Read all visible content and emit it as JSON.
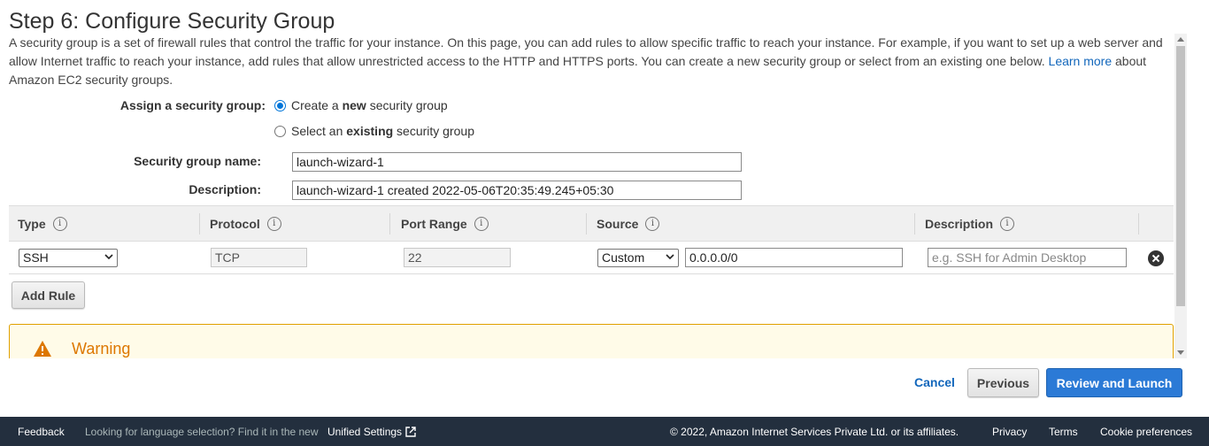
{
  "page": {
    "title": "Step 6: Configure Security Group",
    "intro_text": "A security group is a set of firewall rules that control the traffic for your instance. On this page, you can add rules to allow specific traffic to reach your instance. For example, if you want to set up a web server and allow Internet traffic to reach your instance, add rules that allow unrestricted access to the HTTP and HTTPS ports. You can create a new security group or select from an existing one below.",
    "learn_more_link": "Learn more",
    "intro_suffix": "about Amazon EC2 security groups."
  },
  "assign": {
    "label": "Assign a security group:",
    "option_new": {
      "prefix": "Create a ",
      "bold": "new",
      "suffix": " security group",
      "selected": true
    },
    "option_existing": {
      "prefix": "Select an ",
      "bold": "existing",
      "suffix": " security group",
      "selected": false
    }
  },
  "group_name": {
    "label": "Security group name:",
    "value": "launch-wizard-1"
  },
  "description": {
    "label": "Description:",
    "value": "launch-wizard-1 created 2022-05-06T20:35:49.245+05:30"
  },
  "rules_table": {
    "columns": [
      "Type",
      "Protocol",
      "Port Range",
      "Source",
      "Description"
    ],
    "info_glyph": "i",
    "rows": [
      {
        "type": "SSH",
        "protocol": "TCP",
        "port_range": "22",
        "source_mode": "Custom",
        "source_cidr": "0.0.0.0/0",
        "description_placeholder": "e.g. SSH for Admin Desktop"
      }
    ]
  },
  "add_rule_label": "Add Rule",
  "warning": {
    "title": "Warning",
    "color": "#dd7700"
  },
  "actions": {
    "cancel": "Cancel",
    "previous": "Previous",
    "review_launch": "Review and Launch",
    "primary_color": "#2b7ad6"
  },
  "footer": {
    "feedback": "Feedback",
    "language_note": "Looking for language selection? Find it in the new",
    "unified_settings": "Unified Settings",
    "copyright": "© 2022, Amazon Internet Services Private Ltd. or its affiliates.",
    "privacy": "Privacy",
    "terms": "Terms",
    "cookie_preferences": "Cookie preferences",
    "background": "#232f3e"
  }
}
